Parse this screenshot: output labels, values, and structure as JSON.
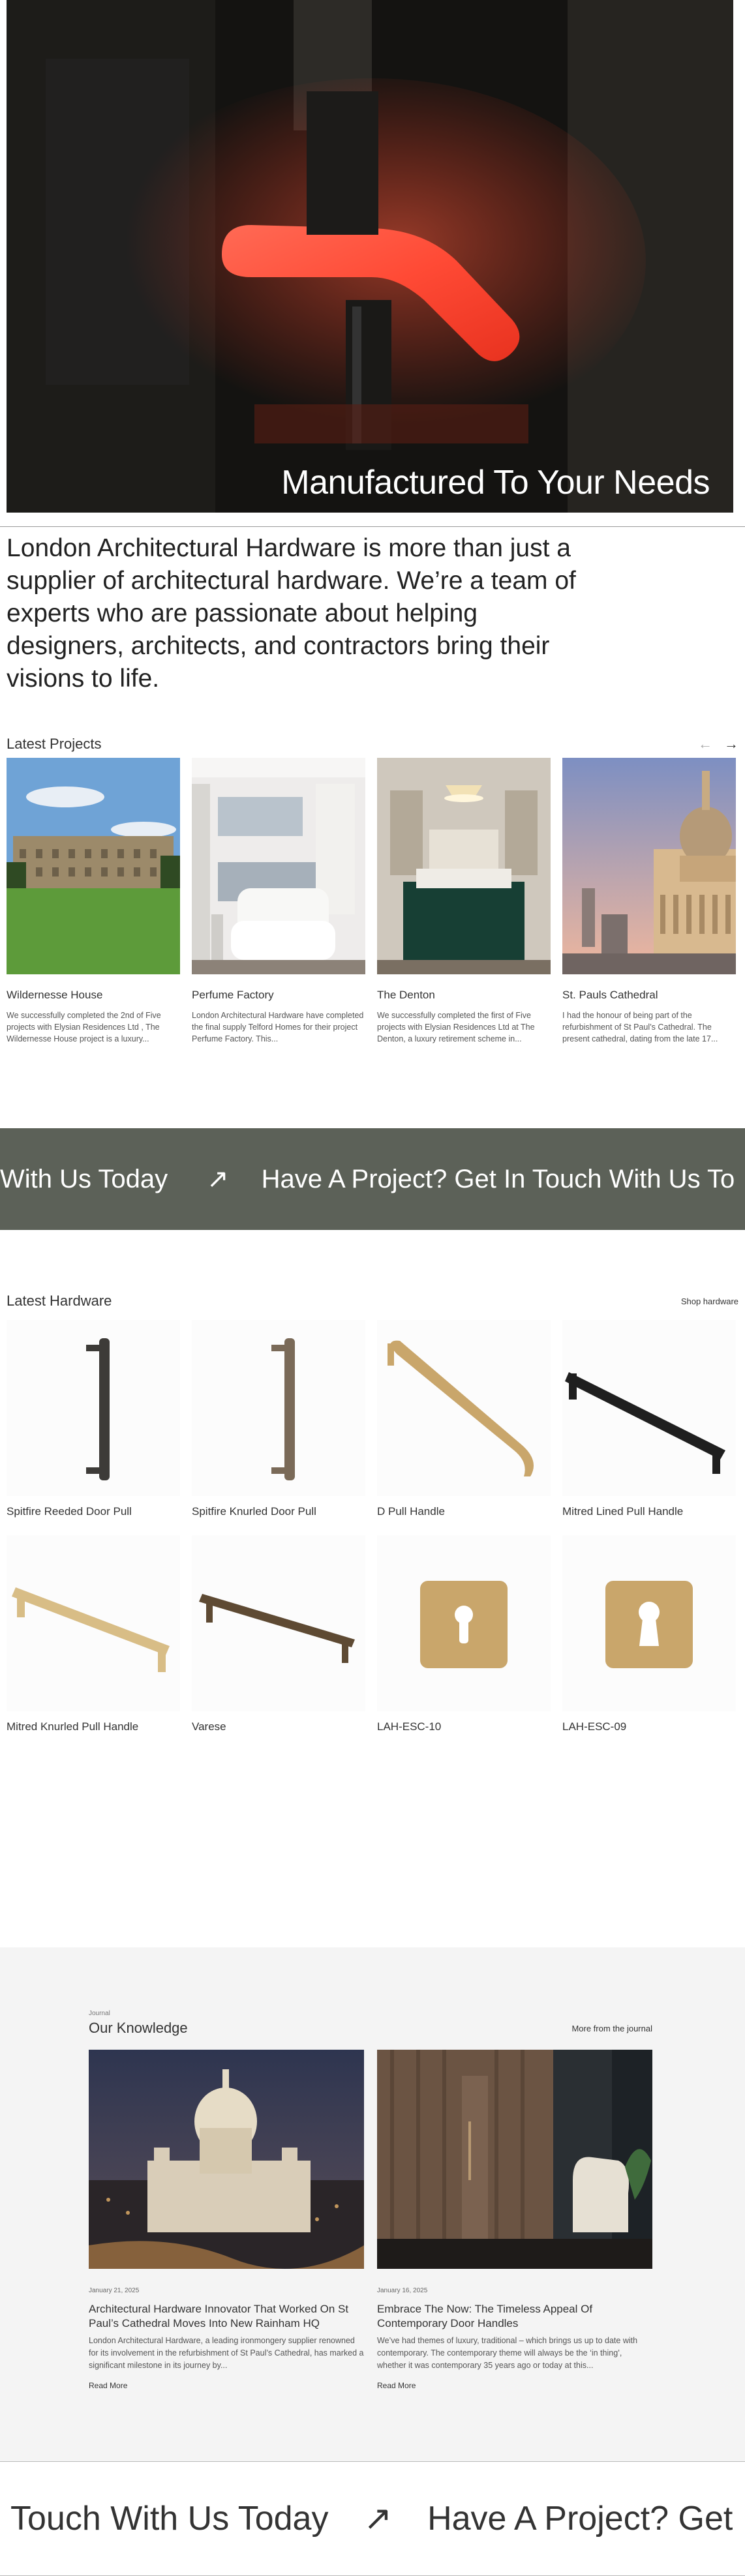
{
  "hero": {
    "title": "Manufactured To Your Needs"
  },
  "intro": {
    "text": "London Architectural Hardware is more than just a supplier of architectural hardware. We’re a team of experts who are passionate about helping designers, architects, and contractors bring their visions to life."
  },
  "projects": {
    "title": "Latest Projects",
    "prev": "←",
    "next": "→",
    "items": [
      {
        "name": "Wildernesse House",
        "desc": "We successfully completed the 2nd of Five projects with Elysian Residences Ltd , The Wildernesse House project is a luxury..."
      },
      {
        "name": "Perfume Factory",
        "desc": "London Architectural Hardware have completed the final supply Telford Homes for their project Perfume Factory. This..."
      },
      {
        "name": "The Denton",
        "desc": "We successfully completed the first of Five projects with Elysian Residences Ltd at The Denton, a luxury retirement scheme in..."
      },
      {
        "name": "St. Pauls Cathedral",
        "desc": "I had the honour of being part of the refurbishment of St Paul’s Cathedral. The present cathedral, dating from the late 17..."
      }
    ]
  },
  "marquee": {
    "text_left": "With Us Today",
    "arrow": "↗",
    "text_right": "Have A Project? Get In Touch With Us To"
  },
  "hardware": {
    "title": "Latest Hardware",
    "shop_label": "Shop hardware",
    "items": [
      {
        "name": "Spitfire Reeded Door Pull"
      },
      {
        "name": "Spitfire Knurled Door Pull"
      },
      {
        "name": "D Pull Handle"
      },
      {
        "name": "Mitred Lined Pull Handle"
      },
      {
        "name": "Mitred Knurled Pull Handle"
      },
      {
        "name": "Varese"
      },
      {
        "name": "LAH-ESC-10"
      },
      {
        "name": "LAH-ESC-09"
      }
    ]
  },
  "journal": {
    "label": "Journal",
    "title": "Our Knowledge",
    "more": "More from the journal",
    "items": [
      {
        "date": "January 21, 2025",
        "title": "Architectural Hardware Innovator That Worked On St Paul’s Cathedral Moves Into New Rainham HQ",
        "excerpt": "London Architectural Hardware, a leading ironmongery supplier renowned for its involvement in the refurbishment of St Paul’s Cathedral, has marked a significant milestone in its journey by...",
        "read": "Read More"
      },
      {
        "date": "January 16, 2025",
        "title": "Embrace The Now: The Timeless Appeal Of Contemporary Door Handles",
        "excerpt": "We’ve had themes of luxury, traditional – which brings us up to date with contemporary. The contemporary theme will always be the ‘in thing’, whether it was contemporary 35 years ago or today at this...",
        "read": "Read More"
      }
    ]
  },
  "footer_marquee": {
    "text_left": "Touch With Us Today",
    "arrow": "↗",
    "text_right": "Have A Project? Get"
  },
  "colors": {
    "marquee_bg": "#5c6158",
    "journal_bg": "#f4f4f4",
    "brass": "#c9a66b",
    "dark_bronze": "#3f3a33"
  }
}
